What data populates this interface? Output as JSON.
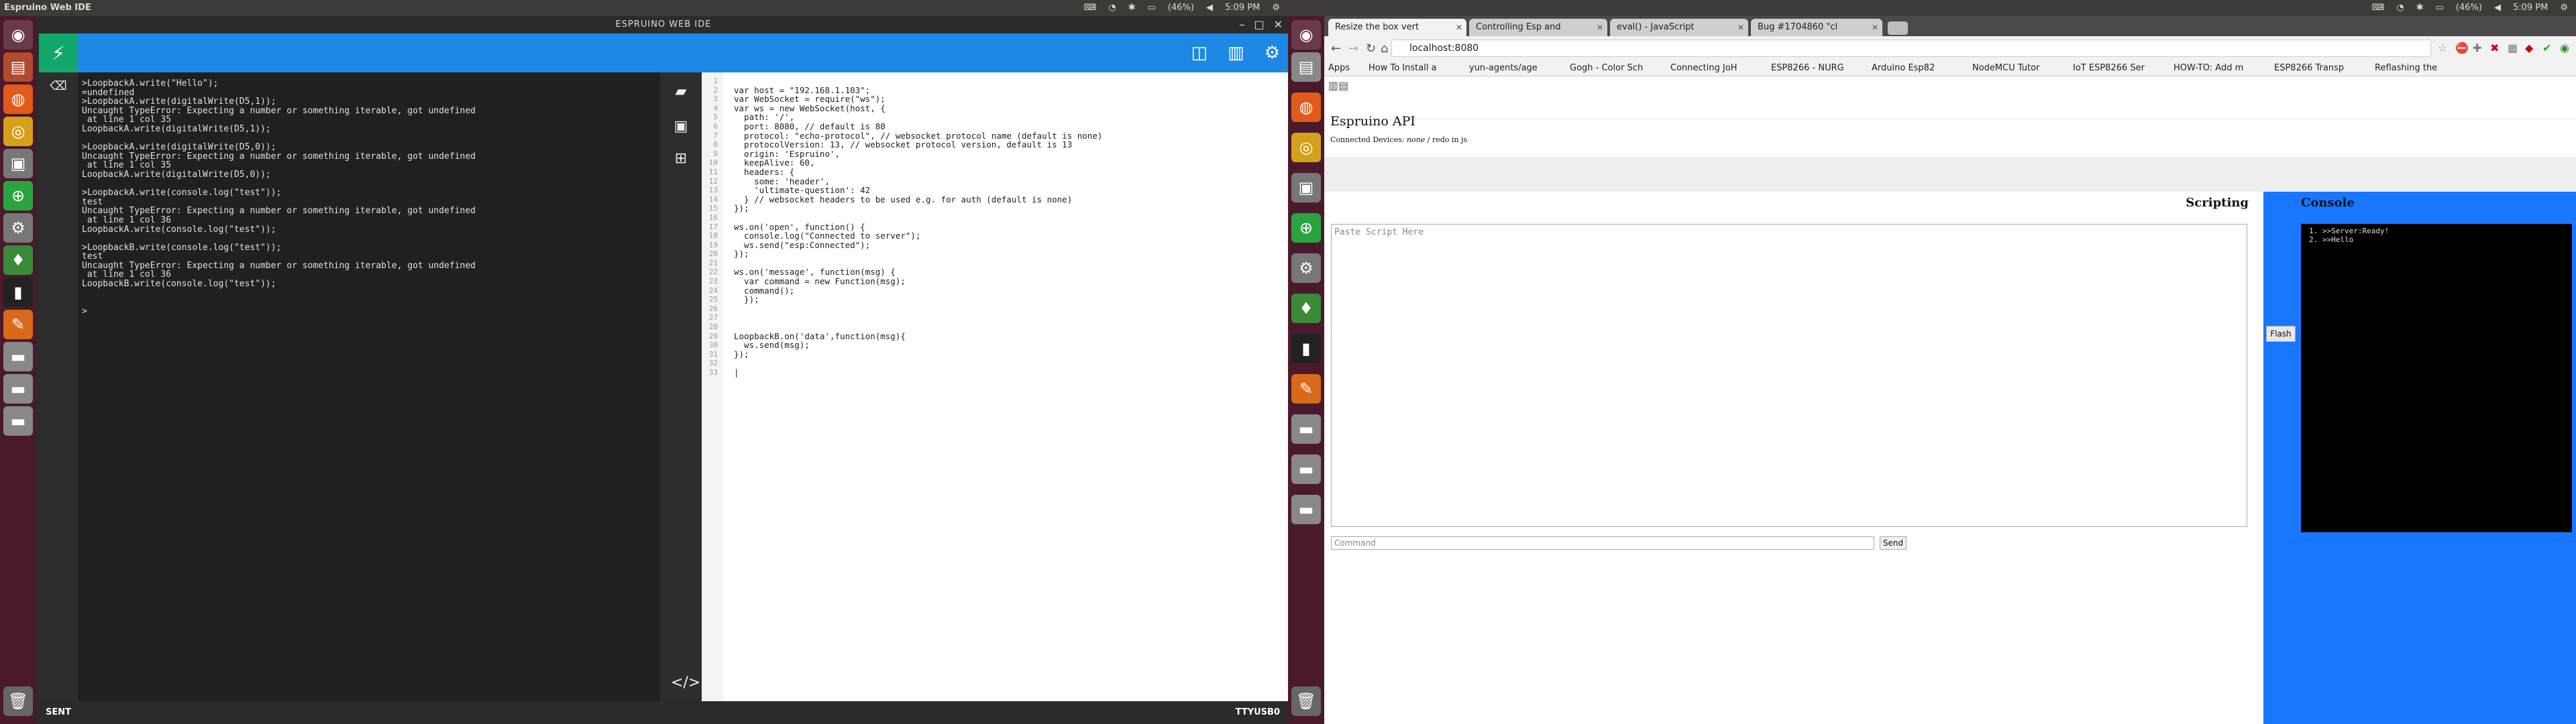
{
  "left_screen": {
    "topbar": {
      "title": "Espruino Web IDE",
      "battery": "(46%)",
      "clock": "5:09 PM"
    },
    "ide": {
      "window_title": "ESPRUINO WEB IDE",
      "terminal_lines": [
        ">LoopbackA.write(\"Hello\");",
        "=undefined",
        ">LoopbackA.write(digitalWrite(D5,1));",
        "Uncaught TypeError: Expecting a number or something iterable, got undefined",
        " at line 1 col 35",
        "LoopbackA.write(digitalWrite(D5,1));",
        "",
        ">LoopbackA.write(digitalWrite(D5,0));",
        "Uncaught TypeError: Expecting a number or something iterable, got undefined",
        " at line 1 col 35",
        "LoopbackA.write(digitalWrite(D5,0));",
        "",
        ">LoopbackA.write(console.log(\"test\"));",
        "test",
        "Uncaught TypeError: Expecting a number or something iterable, got undefined",
        " at line 1 col 36",
        "LoopbackA.write(console.log(\"test\"));",
        "",
        ">LoopbackB.write(console.log(\"test\"));",
        "test",
        "Uncaught TypeError: Expecting a number or something iterable, got undefined",
        " at line 1 col 36",
        "LoopbackB.write(console.log(\"test\"));",
        "",
        "",
        ">"
      ],
      "code_lines": [
        "",
        "var host = \"192.168.1.103\";",
        "var WebSocket = require(\"ws\");",
        "var ws = new WebSocket(host, {",
        "  path: '/',",
        "  port: 8080, // default is 80",
        "  protocol: \"echo-protocol\", // websocket protocol name (default is none)",
        "  protocolVersion: 13, // websocket protocol version, default is 13",
        "  origin: 'Espruino',",
        "  keepAlive: 60,",
        "  headers: {",
        "    some: 'header',",
        "    'ultimate-question': 42",
        "  } // websocket headers to be used e.g. for auth (default is none)",
        "});",
        "",
        "ws.on('open', function() {",
        "  console.log(\"Connected to server\");",
        "  ws.send(\"esp:Connected\");",
        "});",
        "",
        "ws.on('message', function(msg) {",
        "  var command = new Function(msg);",
        "  command();",
        "  });",
        "",
        "",
        "",
        "LoopbackB.on('data',function(msg){",
        "  ws.send(msg);",
        "});",
        "",
        "|"
      ],
      "status_left": "SENT",
      "status_right": "TTYUSB0"
    }
  },
  "right_screen": {
    "topbar": {
      "battery": "(46%)",
      "clock": "5:09 PM"
    },
    "tabs": [
      {
        "label": "Resize the box vert",
        "active": true
      },
      {
        "label": "Controlling Esp and",
        "active": false
      },
      {
        "label": "eval() - JavaScript",
        "active": false
      },
      {
        "label": "Bug #1704860 \"cl",
        "active": false
      }
    ],
    "url": "localhost:8080",
    "bookmarks": [
      "Apps",
      "How To Install a",
      "yun-agents/age",
      "Gogh - Color Sch",
      "Connecting JoH",
      "ESP8266 - NURG",
      "Arduino Esp82",
      "NodeMCU Tutor",
      "IoT ESP8266 Ser",
      "HOW-TO: Add m",
      "ESP8266 Transp",
      "Reflashing the"
    ],
    "page": {
      "heading": "Espruino API",
      "devices_label": "Connected Devices:",
      "devices_value": "none",
      "devices_suffix": "/ redo in js",
      "scripting_title": "Scripting",
      "script_placeholder": "Paste Script Here",
      "command_placeholder": "Command",
      "send_label": "Send",
      "flash_label": "Flash",
      "console_title": "Console",
      "console_lines": [
        "1. >>Server:Ready!",
        "2. >>Hello"
      ]
    }
  }
}
